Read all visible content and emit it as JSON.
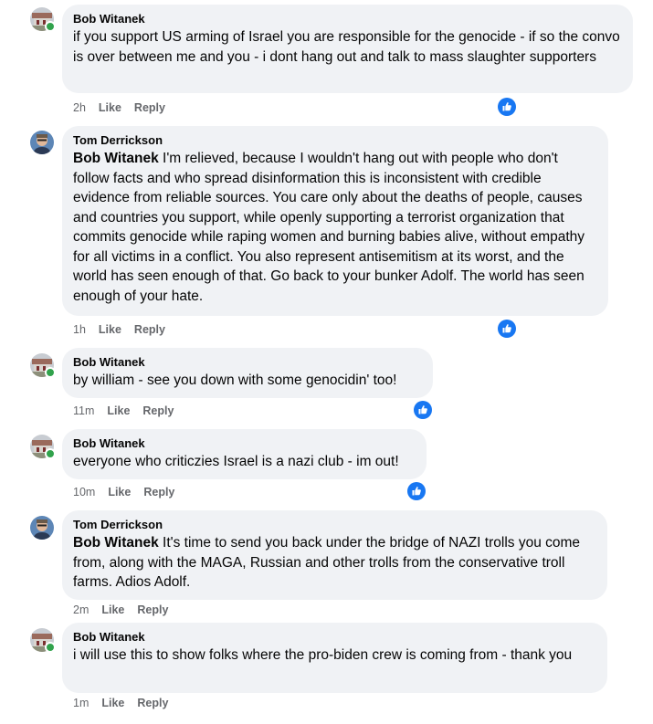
{
  "comments": [
    {
      "author": "Bob Witanek",
      "mention": "",
      "text": "if you support US arming of Israel you are responsible for the genocide - if so the convo is over between me and you - i dont hang out and talk to mass slaughter supporters",
      "time": "2h",
      "like": "Like",
      "reply": "Reply",
      "reaction": "like-icon"
    },
    {
      "author": "Tom Derrickson",
      "mention": "Bob Witanek",
      "text": " I'm relieved, because I wouldn't hang out with people who don't follow facts and who spread disinformation this is inconsistent with credible evidence from reliable sources. You care only about the deaths of people, causes and countries you support, while openly supporting a terrorist organization that commits genocide while raping women and burning babies alive, without empathy for all victims in a conflict. You also represent antisemitism at its worst, and the world has seen enough of that. Go back to your bunker Adolf. The world has seen enough of your hate.",
      "time": "1h",
      "like": "Like",
      "reply": "Reply",
      "reaction": "like-icon"
    },
    {
      "author": "Bob Witanek",
      "mention": "",
      "text": "by william - see you down with some genocidin' too!",
      "time": "11m",
      "like": "Like",
      "reply": "Reply",
      "reaction": "like-icon"
    },
    {
      "author": "Bob Witanek",
      "mention": "",
      "text": "everyone who criticzies Israel is a nazi club - im out!",
      "time": "10m",
      "like": "Like",
      "reply": "Reply",
      "reaction": "like-icon"
    },
    {
      "author": "Tom Derrickson",
      "mention": "Bob Witanek",
      "text": " It's time to send you back under the bridge of NAZI trolls you come from, along with the MAGA, Russian and other trolls from the conservative troll farms. Adios Adolf.",
      "time": "2m",
      "like": "Like",
      "reply": "Reply",
      "reaction": ""
    },
    {
      "author": "Bob Witanek",
      "mention": "",
      "text": "i will use this to show folks where the pro-biden crew is coming from - thank you",
      "time": "1m",
      "like": "Like",
      "reply": "Reply",
      "reaction": ""
    }
  ],
  "colors": {
    "bubble": "#f0f2f5",
    "meta": "#65676b",
    "like_blue": "#1877f2",
    "online": "#31a24c"
  }
}
